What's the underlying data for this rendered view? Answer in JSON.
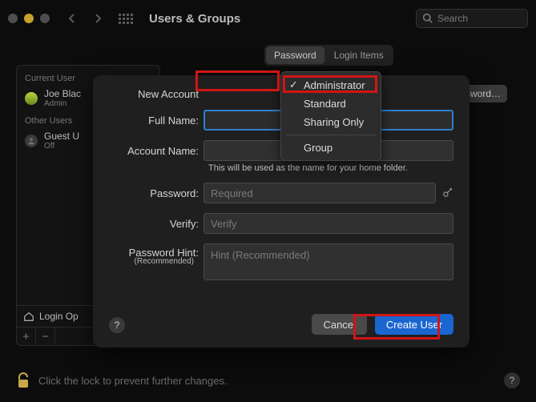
{
  "window": {
    "title": "Users & Groups",
    "search_placeholder": "Search"
  },
  "tabs": {
    "password": "Password",
    "login_items": "Login Items"
  },
  "change_password_btn": "sword…",
  "sidebar": {
    "section_current": "Current User",
    "section_other": "Other Users",
    "current": {
      "name": "Joe Blac",
      "role": "Admin"
    },
    "guest": {
      "name": "Guest U",
      "status": "Off"
    },
    "login_options": "Login Op"
  },
  "sheet": {
    "labels": {
      "new_account": "New Account",
      "full_name": "Full Name:",
      "account_name": "Account Name:",
      "account_hint": "This will be used as the name for your home folder.",
      "password": "Password:",
      "verify": "Verify:",
      "hint": "Password Hint:",
      "hint_sub": "(Recommended)"
    },
    "placeholders": {
      "password": "Required",
      "verify": "Verify",
      "hint": "Hint (Recommended)"
    },
    "dropdown": {
      "selected": "Administrator",
      "items": [
        "Administrator",
        "Standard",
        "Sharing Only"
      ],
      "group": "Group"
    },
    "buttons": {
      "cancel": "Cancel",
      "create": "Create User"
    }
  },
  "footer": {
    "lock_text": "Click the lock to prevent further changes."
  }
}
